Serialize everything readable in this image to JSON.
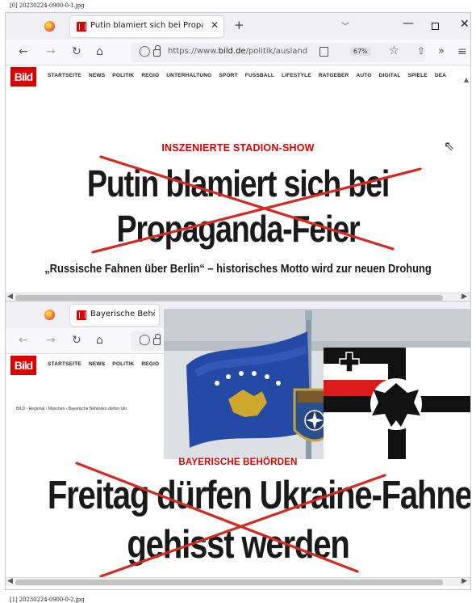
{
  "files": {
    "top": "[0] 20230224-0900-0-1.jpg",
    "bottom": "[1] 20230224-0900-0-2.jpg"
  },
  "shot1": {
    "tab_title": "Putin blamiert sich bei Propaga",
    "url_prefix": "https://www.",
    "url_domain": "bild.de",
    "url_path": "/politik/ausland",
    "zoom": "67%",
    "kicker": "INSZENIERTE STADION-SHOW",
    "headline_line1": "Putin blamiert sich bei",
    "headline_line2": "Propaganda-Feier",
    "subline": "„Russische Fahnen über Berlin“ – historisches Motto wird zur neuen Drohung"
  },
  "shot2": {
    "tab_title": "Bayerische Behörden",
    "breadcrumb": "BILD › Regional › München › Bayerische Behörden dürfen Ukr",
    "kicker": "BAYERISCHE BEHÖRDEN",
    "headline_line1": "Freitag dürfen Ukraine-Fahne",
    "headline_line2": "gehisst werden"
  },
  "bild_logo": "Bild",
  "bild_menu": [
    "STARTSEITE",
    "NEWS",
    "POLITIK",
    "REGIO",
    "UNTERHALTUNG",
    "SPORT",
    "FUSSBALL",
    "LIFESTYLE",
    "RATGEBER",
    "AUTO",
    "DIGITAL",
    "SPIELE",
    "DEA"
  ],
  "bild_menu_short": [
    "STARTSEITE",
    "NEWS",
    "POLITIK",
    "REGIO"
  ],
  "colors": {
    "bild_red": "#de0000",
    "cross_red": "#d42a20",
    "kosovo_blue": "#244aa5",
    "kosovo_gold": "#d0a72d"
  }
}
